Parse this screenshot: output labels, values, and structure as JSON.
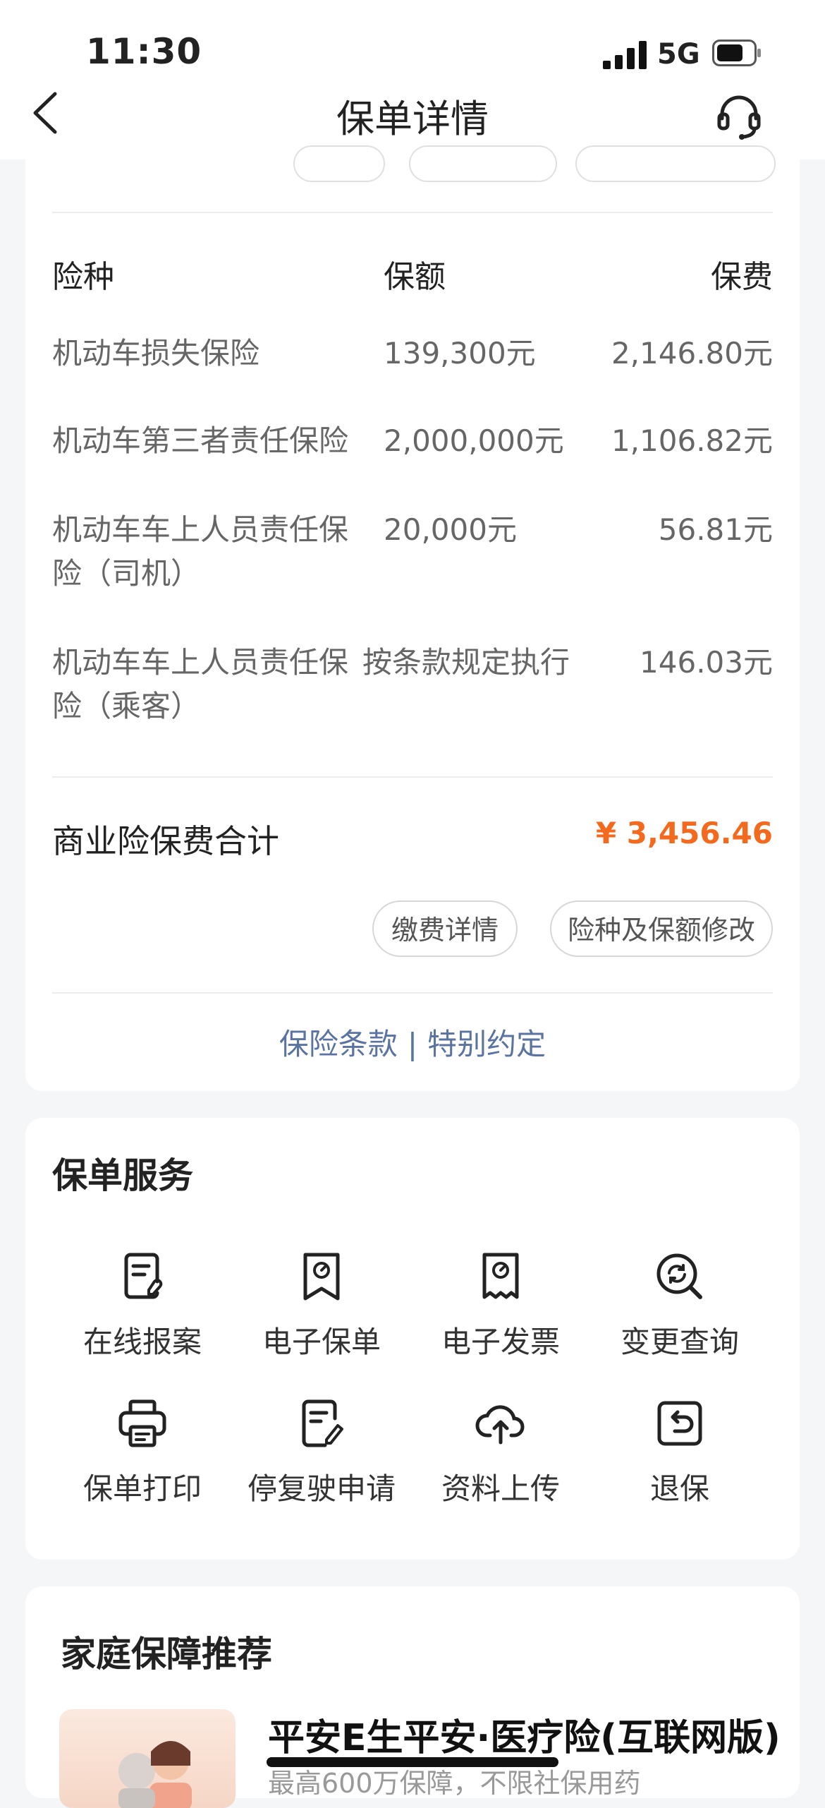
{
  "status": {
    "time": "11:30",
    "network": "5G"
  },
  "nav": {
    "title": "保单详情"
  },
  "coverage": {
    "headers": {
      "type": "险种",
      "amount": "保额",
      "premium": "保费"
    },
    "rows": [
      {
        "name": "机动车损失保险",
        "amount": "139,300元",
        "premium": "2,146.80元"
      },
      {
        "name": "机动车第三者责任保险",
        "amount": "2,000,000元",
        "premium": "1,106.82元"
      },
      {
        "name": "机动车车上人员责任保险（司机）",
        "amount": "20,000元",
        "premium": "56.81元"
      },
      {
        "name": "机动车车上人员责任保险（乘客）",
        "amount": "按条款规定执行",
        "premium": "146.03元"
      }
    ],
    "total_label": "商业险保费合计",
    "total_value": "¥ 3,456.46",
    "pay_detail_button": "缴费详情",
    "modify_button": "险种及保额修改",
    "terms_link": "保险条款",
    "link_separator": "|",
    "special_link": "特别约定"
  },
  "services": {
    "title": "保单服务",
    "items": [
      {
        "label": "在线报案",
        "icon": "report-doc-icon"
      },
      {
        "label": "电子保单",
        "icon": "bookmark-seal-icon"
      },
      {
        "label": "电子发票",
        "icon": "receipt-icon"
      },
      {
        "label": "变更查询",
        "icon": "refresh-search-icon"
      },
      {
        "label": "保单打印",
        "icon": "printer-icon"
      },
      {
        "label": "停复驶申请",
        "icon": "edit-doc-icon"
      },
      {
        "label": "资料上传",
        "icon": "cloud-upload-icon"
      },
      {
        "label": "退保",
        "icon": "return-icon"
      }
    ]
  },
  "recommend": {
    "title": "家庭保障推荐",
    "product_title": "平安E生平安·医疗险(互联网版)",
    "product_sub": "最高600万保障，不限社保用药"
  }
}
